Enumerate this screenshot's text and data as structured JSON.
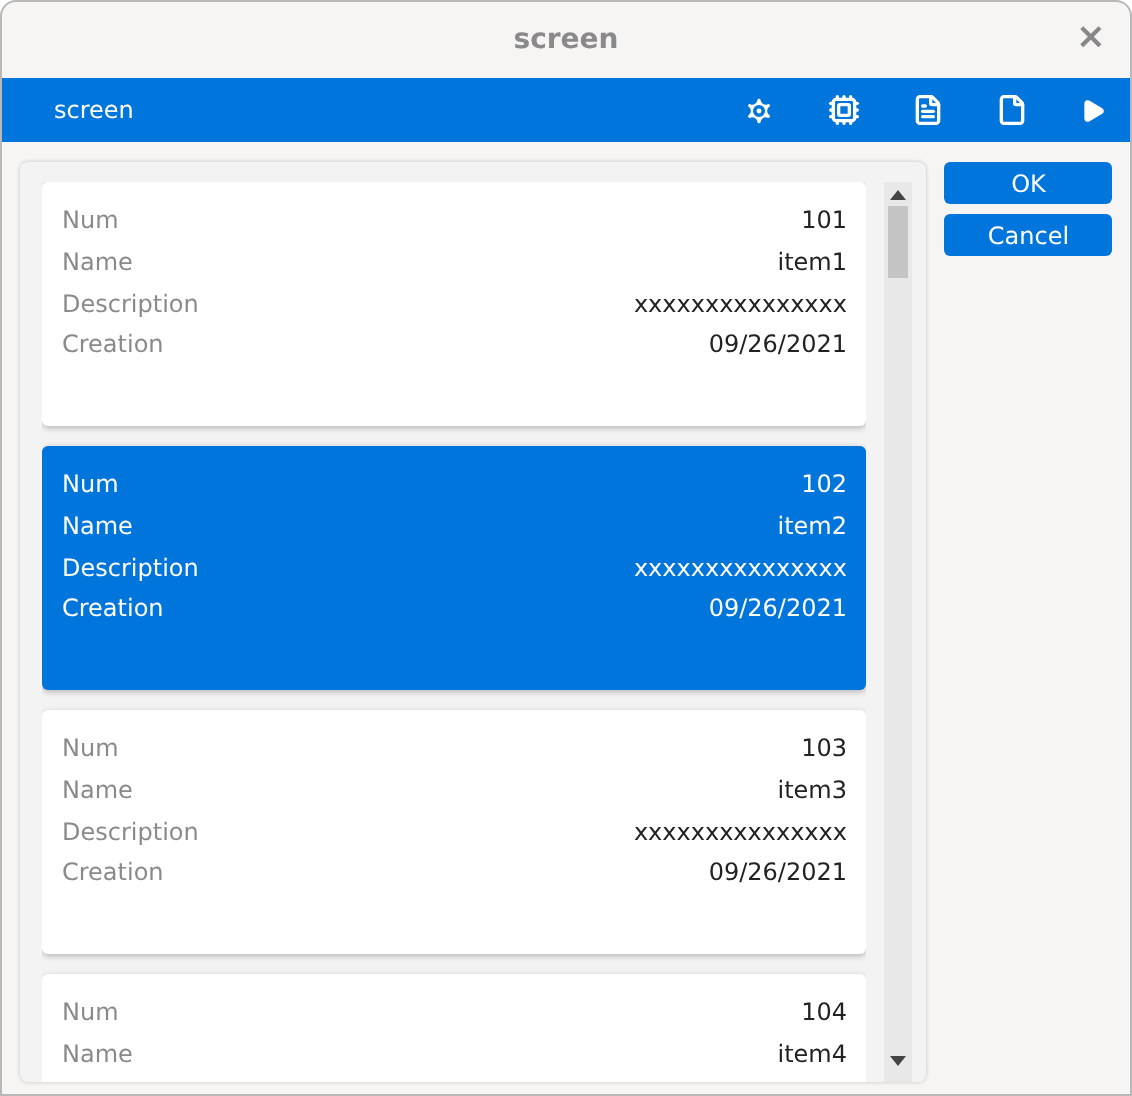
{
  "window": {
    "title": "screen",
    "close": "×"
  },
  "toolbar": {
    "title": "screen"
  },
  "cards": [
    {
      "selected": false,
      "fields": [
        {
          "label": "Num",
          "value": "101"
        },
        {
          "label": "Name",
          "value": "item1"
        },
        {
          "label": "Description",
          "value": "xxxxxxxxxxxxxxx"
        },
        {
          "label": "Creation",
          "value": "09/26/2021"
        }
      ]
    },
    {
      "selected": true,
      "fields": [
        {
          "label": "Num",
          "value": "102"
        },
        {
          "label": "Name",
          "value": "item2"
        },
        {
          "label": "Description",
          "value": "xxxxxxxxxxxxxxx"
        },
        {
          "label": "Creation",
          "value": "09/26/2021"
        }
      ]
    },
    {
      "selected": false,
      "fields": [
        {
          "label": "Num",
          "value": "103"
        },
        {
          "label": "Name",
          "value": "item3"
        },
        {
          "label": "Description",
          "value": "xxxxxxxxxxxxxxx"
        },
        {
          "label": "Creation",
          "value": "09/26/2021"
        }
      ]
    },
    {
      "selected": false,
      "fields": [
        {
          "label": "Num",
          "value": "104"
        },
        {
          "label": "Name",
          "value": "item4"
        }
      ]
    }
  ],
  "buttons": [
    "OK",
    "Cancel"
  ]
}
